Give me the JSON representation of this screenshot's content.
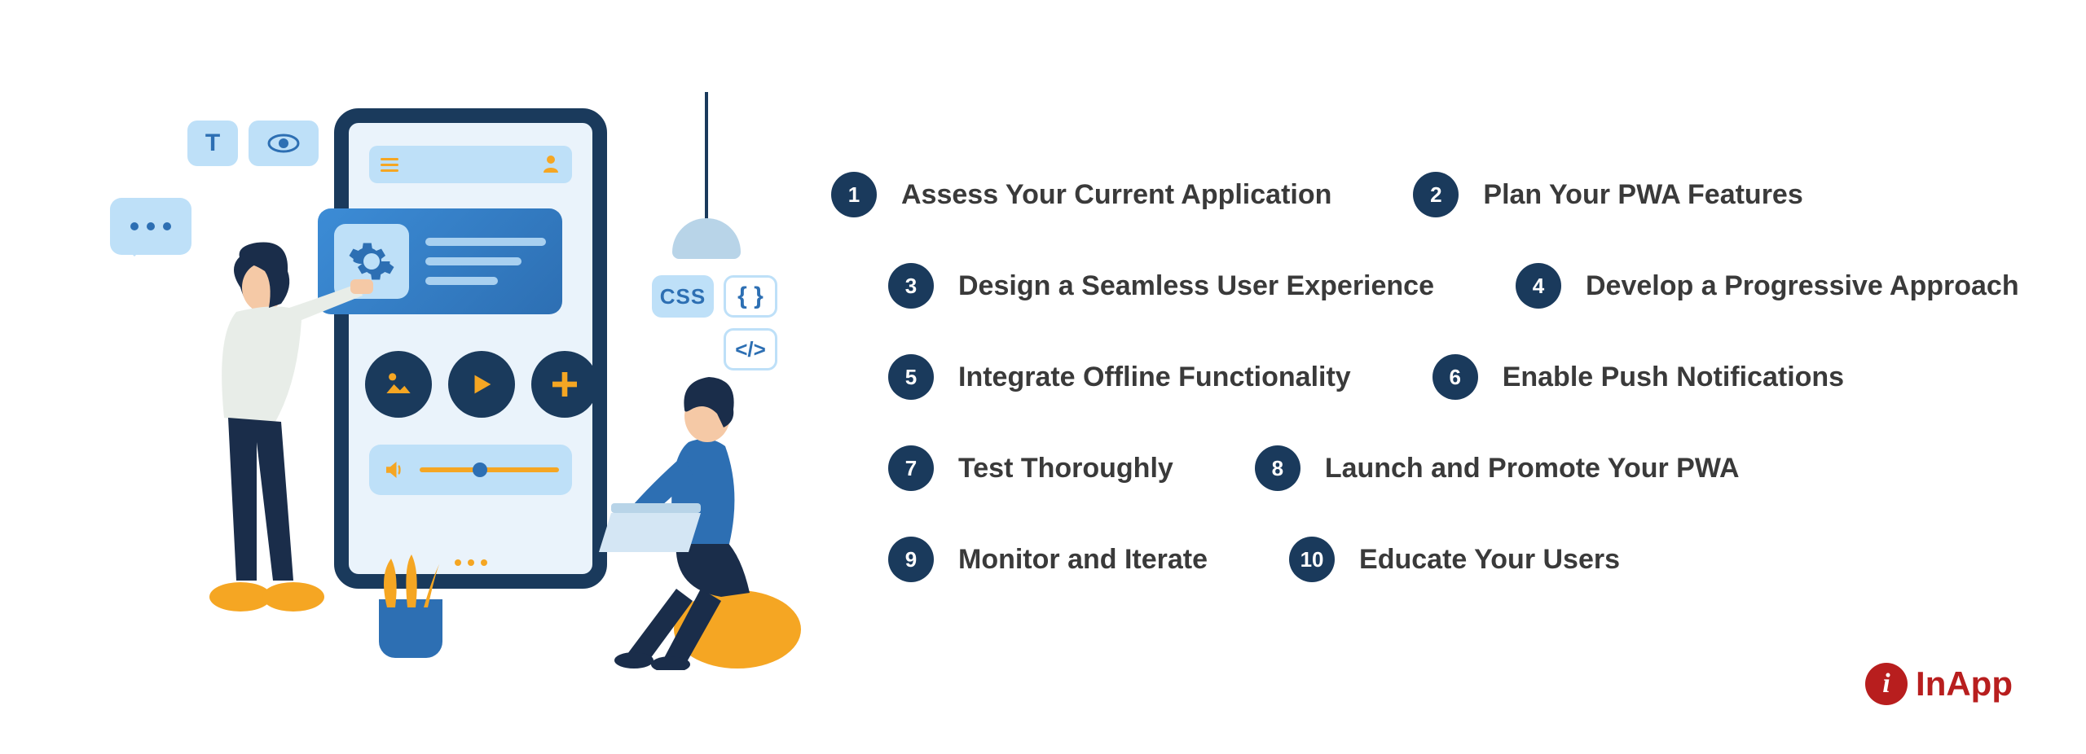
{
  "steps": [
    {
      "num": "1",
      "label": "Assess Your Current Application"
    },
    {
      "num": "2",
      "label": "Plan Your PWA Features"
    },
    {
      "num": "3",
      "label": "Design a Seamless User Experience"
    },
    {
      "num": "4",
      "label": "Develop a Progressive Approach"
    },
    {
      "num": "5",
      "label": "Integrate Offline Functionality"
    },
    {
      "num": "6",
      "label": "Enable Push Notifications"
    },
    {
      "num": "7",
      "label": "Test Thoroughly"
    },
    {
      "num": "8",
      "label": "Launch and Promote Your PWA"
    },
    {
      "num": "9",
      "label": "Monitor and Iterate"
    },
    {
      "num": "10",
      "label": "Educate Your Users"
    }
  ],
  "badges": {
    "text": "T",
    "css": "CSS",
    "braces": "{ }",
    "code": "</>"
  },
  "brand": {
    "icon_letter": "i",
    "name": "InApp"
  },
  "colors": {
    "primary_dark": "#1a3a5c",
    "primary_blue": "#2d6fb3",
    "light_blue": "#bee0f8",
    "accent_orange": "#f5a623",
    "brand_red": "#b81e1e",
    "text_gray": "#3a3a3a"
  }
}
